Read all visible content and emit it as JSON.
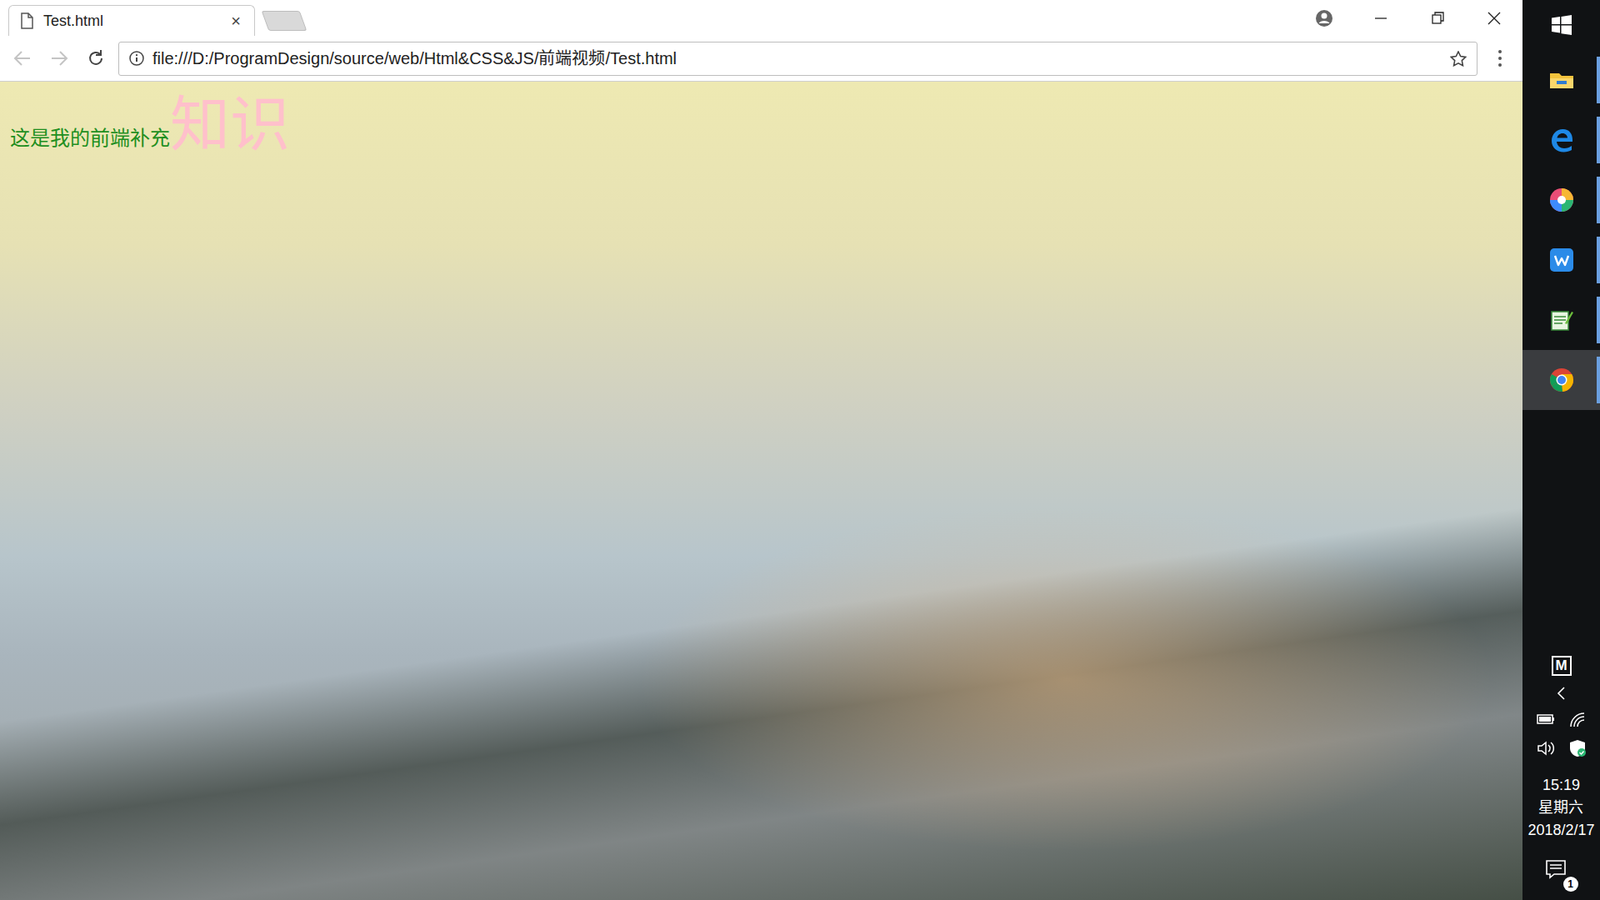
{
  "window": {
    "title": "Test.html"
  },
  "tabs": [
    {
      "label": "Test.html",
      "close": "×",
      "selected": true
    }
  ],
  "navigation": {
    "back_disabled": true,
    "forward_disabled": true
  },
  "address_bar": {
    "url": "file:///D:/ProgramDesign/source/web/Html&CSS&JS/前端视频/Test.html"
  },
  "page": {
    "text": "这是我的前端补充",
    "emphasis": "知识"
  },
  "taskbar": {
    "apps": [
      {
        "kind": "explorer",
        "running": true,
        "selected": false
      },
      {
        "kind": "edge",
        "running": true,
        "selected": false
      },
      {
        "kind": "photos",
        "running": true,
        "selected": false
      },
      {
        "kind": "wps",
        "running": true,
        "selected": false
      },
      {
        "kind": "notepad",
        "running": true,
        "selected": false
      },
      {
        "kind": "chrome",
        "running": true,
        "selected": true
      }
    ],
    "tray_app": "M",
    "tray": [
      {
        "kind": "battery"
      },
      {
        "kind": "wifi"
      },
      {
        "kind": "volume"
      },
      {
        "kind": "security"
      }
    ],
    "time": "15:19",
    "weekday": "星期六",
    "date": "2018/2/17",
    "notification_count": "1"
  }
}
